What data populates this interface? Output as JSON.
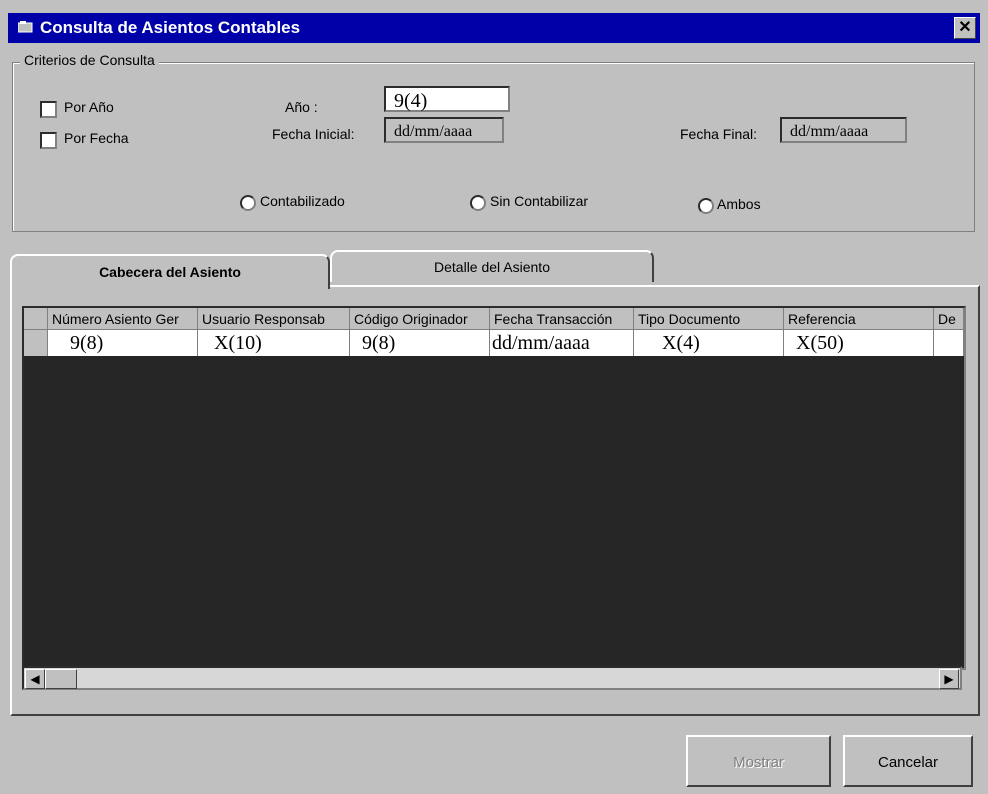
{
  "window": {
    "title": "Consulta de Asientos Contables"
  },
  "criteria": {
    "legend": "Criterios de Consulta",
    "por_anio_label": "Por Año",
    "por_fecha_label": "Por Fecha",
    "anio_label": "Año :",
    "anio_value": "9(4)",
    "fecha_inicial_label": "Fecha Inicial:",
    "fecha_inicial_value": "dd/mm/aaaa",
    "fecha_final_label": "Fecha Final:",
    "fecha_final_value": "dd/mm/aaaa",
    "radio_contabilizado": "Contabilizado",
    "radio_sin_contabilizar": "Sin Contabilizar",
    "radio_ambos": "Ambos"
  },
  "tabs": [
    {
      "label": "Cabecera del Asiento",
      "active": true
    },
    {
      "label": "Detalle del Asiento",
      "active": false
    }
  ],
  "table": {
    "columns": [
      "Número Asiento Ger",
      "Usuario Responsab",
      "Código Originador",
      "Fecha Transacción",
      "Tipo Documento",
      "Referencia",
      "De"
    ],
    "row": [
      "9(8)",
      "X(10)",
      "9(8)",
      "dd/mm/aaaa",
      "X(4)",
      "X(50)",
      ""
    ]
  },
  "buttons": {
    "mostrar": "Mostrar",
    "cancelar": "Cancelar"
  },
  "colors": {
    "title_bar": "#0000a8",
    "window_bg": "#c0c0c0",
    "grid_bg": "#262626"
  }
}
